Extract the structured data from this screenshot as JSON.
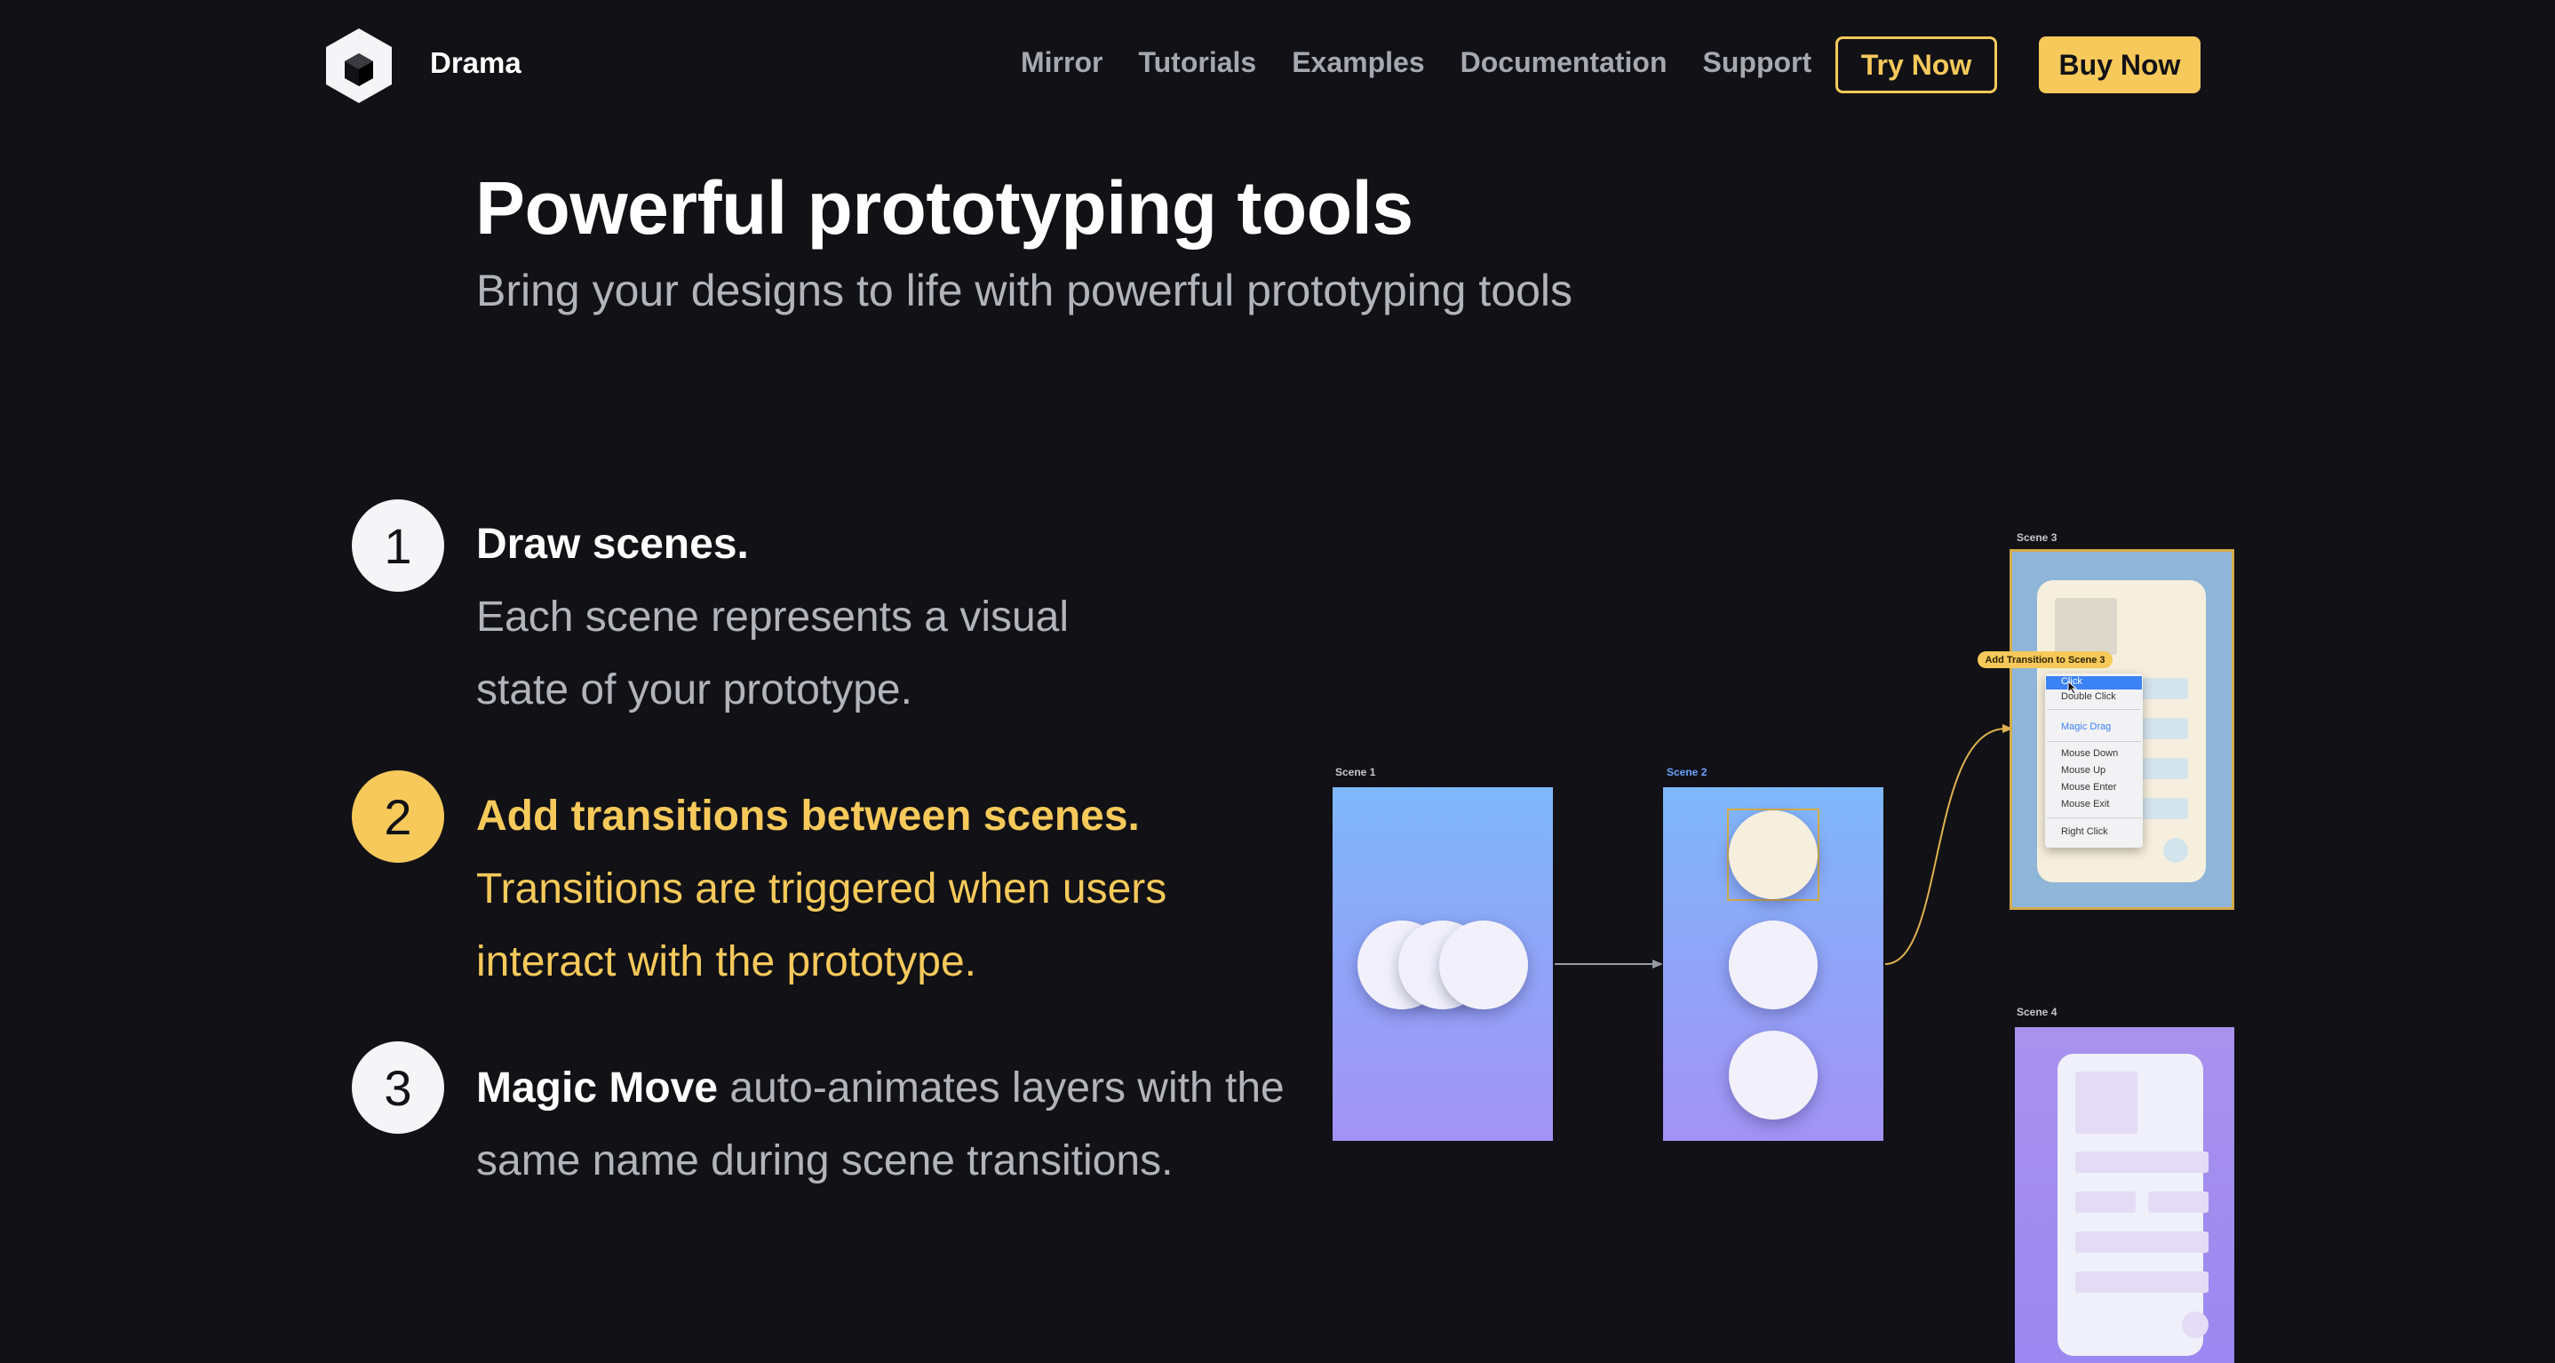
{
  "nav": {
    "brand": "Drama",
    "links": [
      "Mirror",
      "Tutorials",
      "Examples",
      "Documentation",
      "Support"
    ],
    "try_label": "Try Now",
    "buy_label": "Buy Now"
  },
  "hero": {
    "title": "Powerful prototyping tools",
    "subtitle": "Bring your designs to life with powerful prototyping tools"
  },
  "steps": [
    {
      "number": "1",
      "title": "Draw scenes.",
      "desc": "Each scene represents a visual state of your prototype."
    },
    {
      "number": "2",
      "title": "Add transitions between scenes.",
      "desc": "Transitions are triggered when users interact with the prototype."
    },
    {
      "number": "3",
      "title": "Magic Move",
      "desc": "auto-animates layers with the same name during scene transitions."
    }
  ],
  "diagram": {
    "scene_labels": [
      "Scene 1",
      "Scene 2",
      "Scene 3",
      "Scene 4"
    ],
    "transition_tag": "Add Transition to Scene 3",
    "menu_items": [
      "Click",
      "Double Click",
      "Magic Drag",
      "Mouse Down",
      "Mouse Up",
      "Mouse Enter",
      "Mouse Exit",
      "Right Click"
    ]
  },
  "colors": {
    "background": "#111116",
    "accent": "#f7c95a",
    "muted_text": "#b3b3ba"
  }
}
